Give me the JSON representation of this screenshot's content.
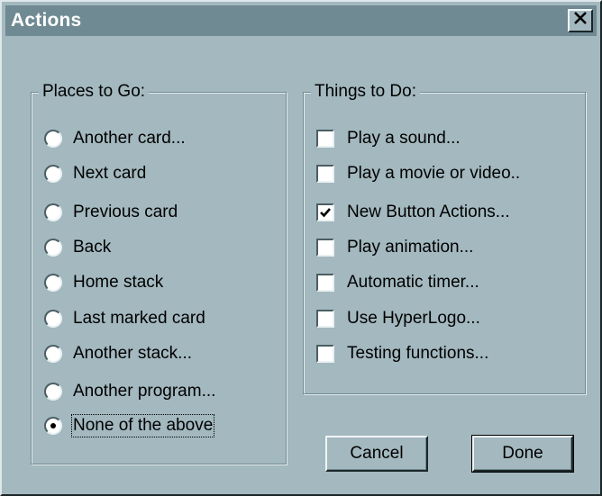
{
  "window": {
    "title": "Actions",
    "close_glyph": "✕"
  },
  "places": {
    "legend": "Places to Go:",
    "options": [
      {
        "label": "Another card...",
        "selected": false
      },
      {
        "label": "Next card",
        "selected": false
      },
      {
        "label": "Previous card",
        "selected": false
      },
      {
        "label": "Back",
        "selected": false
      },
      {
        "label": "Home stack",
        "selected": false
      },
      {
        "label": "Last marked card",
        "selected": false
      },
      {
        "label": "Another stack...",
        "selected": false
      },
      {
        "label": "Another program...",
        "selected": false
      },
      {
        "label": "None of the above",
        "selected": true
      }
    ]
  },
  "things": {
    "legend": "Things to Do:",
    "options": [
      {
        "label": "Play a sound...",
        "checked": false
      },
      {
        "label": "Play a movie or video..",
        "checked": false
      },
      {
        "label": "New Button Actions...",
        "checked": true
      },
      {
        "label": "Play animation...",
        "checked": false
      },
      {
        "label": "Automatic timer...",
        "checked": false
      },
      {
        "label": "Use HyperLogo...",
        "checked": false
      },
      {
        "label": "Testing functions...",
        "checked": false
      }
    ]
  },
  "buttons": {
    "cancel": "Cancel",
    "done": "Done"
  },
  "colors": {
    "dialog_bg": "#a3b8bf",
    "titlebar": "#6f8a92",
    "title_text": "#ffffff"
  }
}
